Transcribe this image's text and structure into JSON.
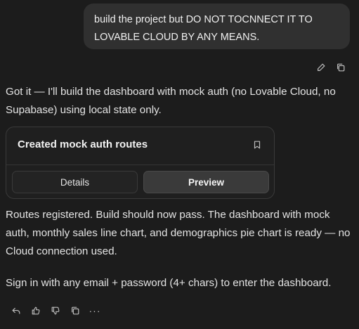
{
  "user_message": {
    "text": "build the project but DO NOT TOCNNECT IT TO LOVABLE CLOUD BY ANY MEANS."
  },
  "user_actions": {
    "icons": [
      "edit-icon",
      "copy-icon"
    ]
  },
  "assistant": {
    "intro": "Got it — I'll build the dashboard with mock auth (no Lovable Cloud, no Supabase) using local state only.",
    "card": {
      "title": "Created mock auth routes",
      "details_label": "Details",
      "preview_label": "Preview"
    },
    "body1": "Routes registered. Build should now pass. The dashboard with mock auth, monthly sales line chart, and demographics pie chart is ready — no Cloud connection used.",
    "body2": "Sign in with any email + password (4+ chars) to enter the dashboard.",
    "more_label": "···",
    "action_icons": [
      "undo-icon",
      "thumbs-up-icon",
      "thumbs-down-icon",
      "copy-icon",
      "more-icon"
    ]
  },
  "colors": {
    "background": "#1c1c1c",
    "user_bubble": "#303030",
    "card_border": "#3a3a3a",
    "preview_button": "#3a3a3a",
    "text": "#e4e4e4"
  }
}
